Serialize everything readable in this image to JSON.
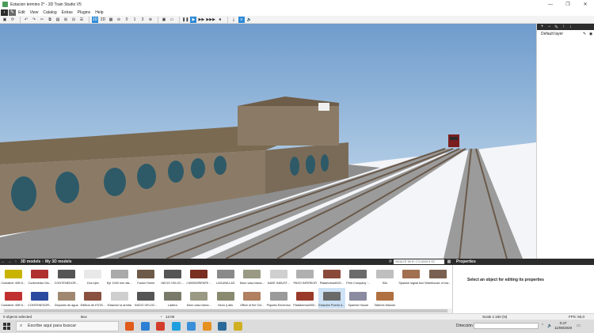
{
  "window": {
    "title": "Estacion termino 2* - 3D Train Studio V5",
    "controls": [
      "—",
      "❐",
      "✕"
    ]
  },
  "menu": {
    "items": [
      "Edit",
      "View",
      "Catalog",
      "Extras",
      "Plugins",
      "Help"
    ]
  },
  "toolbar": {
    "view_3d": "3D",
    "view_2d": "2D",
    "counter_a": "0",
    "counter_b": "1",
    "counter_c": "3"
  },
  "layers": {
    "items": [
      {
        "name": "Default layer"
      }
    ]
  },
  "catalog": {
    "breadcrumb": [
      "3D models",
      "My 3D models"
    ],
    "search_placeholder": "Search term | Content ID",
    "row1": [
      {
        "label": "Container 40ft N...",
        "color": "#c8b400"
      },
      {
        "label": "Contenedor Dis...",
        "color": "#b03030"
      },
      {
        "label": "CONTENEDOR...",
        "color": "#555555"
      },
      {
        "label": "Dos ejes",
        "color": "#e8e8e8"
      },
      {
        "label": "Eje 1000 mm dia...",
        "color": "#aaaaaa"
      },
      {
        "label": "Factor Home",
        "color": "#6d5a48"
      },
      {
        "label": "INICIO VELOC...",
        "color": "#555555"
      },
      {
        "label": "J 600000RENFE ...",
        "color": "#7a2f22"
      },
      {
        "label": "LAGUNILLAS",
        "color": "#8a8a8a"
      },
      {
        "label": "Muro vaso blanc...",
        "color": "#9a9a84"
      },
      {
        "label": "NAVE INDUST...",
        "color": "#cfcfcf"
      },
      {
        "label": "PASO INFERIOR",
        "color": "#b0b0b0"
      },
      {
        "label": "Plataforma4000...",
        "color": "#8a4a3a"
      },
      {
        "label": "Prim Company '...",
        "color": "#6b6b6b"
      },
      {
        "label": "Silo",
        "color": "#bfbfbf"
      },
      {
        "label": "Spanish signal box",
        "color": "#a07050"
      },
      {
        "label": "Warehouse of ma...",
        "color": "#7a6050"
      }
    ],
    "row2": [
      {
        "label": "Container 40ft N...",
        "color": "#c03030"
      },
      {
        "label": "CONTENEDOR...",
        "color": "#2a4aa0"
      },
      {
        "label": "Deposito de agua",
        "color": "#a08870"
      },
      {
        "label": "Edificio de ESTA...",
        "color": "#8a5040"
      },
      {
        "label": "Estacion la armita",
        "color": "#cfcfcf"
      },
      {
        "label": "INICIO VELOC...",
        "color": "#555555"
      },
      {
        "label": "Ladera",
        "color": "#7a7a6a"
      },
      {
        "label": "Muro vaso blanc...",
        "color": "#9a9a84"
      },
      {
        "label": "Muro Ij alto",
        "color": "#8a8a70"
      },
      {
        "label": "Office of the Chi...",
        "color": "#b08060"
      },
      {
        "label": "Piqueta Enneroso",
        "color": "#9a9a9a"
      },
      {
        "label": "Plataforma4000...",
        "color": "#9a3a2a"
      },
      {
        "label": "Estación Puerto d...",
        "color": "#6a6a6a",
        "selected": true
      },
      {
        "label": "Spanish House",
        "color": "#8a8aa0"
      },
      {
        "label": "Talleres Manolo",
        "color": "#b07040"
      }
    ]
  },
  "properties": {
    "title": "Properties",
    "message": "Select an object for editing its properties"
  },
  "status": {
    "selected": "0 objects selected",
    "mode": "Box",
    "time": "12:00",
    "scale": "Scale 1:160 (N)",
    "fps": "FPS: 60,0"
  },
  "taskbar": {
    "search_placeholder": "Escribe aquí para buscar",
    "address_label": "Dirección",
    "clock_time": "0:47",
    "clock_date": "11/08/2020",
    "apps": [
      "#e05a1a",
      "#2d7fd3",
      "#d33b2b",
      "#1ea0e0",
      "#3a8fd8",
      "#e69020",
      "#2a6a9a",
      "#d0b020"
    ]
  }
}
